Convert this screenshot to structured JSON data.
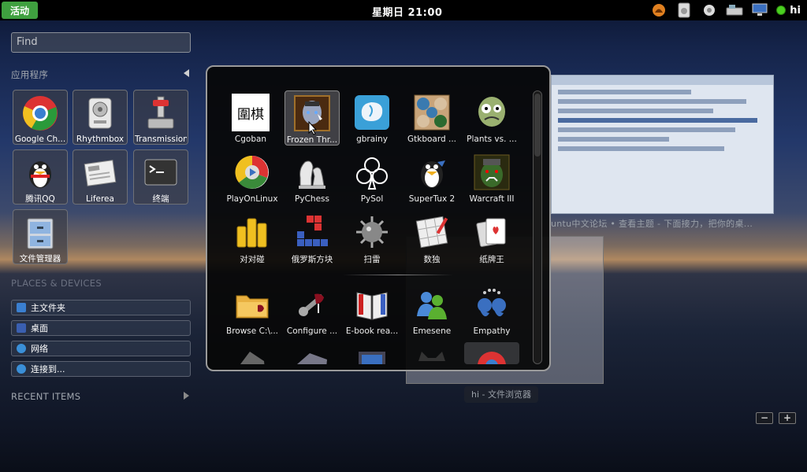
{
  "topbar": {
    "activities": "活动",
    "clock": "星期日 21:00",
    "user": "hi",
    "icons": [
      "user-avatar-icon",
      "removable-device-icon",
      "volume-icon",
      "keyboard-icon",
      "network-icon"
    ]
  },
  "search": {
    "placeholder": "Find"
  },
  "sidebar": {
    "apps_heading": "应用程序",
    "favorites": [
      {
        "label": "Google Ch...",
        "icon": "chrome-icon"
      },
      {
        "label": "Rhythmbox",
        "icon": "rhythmbox-icon"
      },
      {
        "label": "Transmission",
        "icon": "transmission-icon"
      },
      {
        "label": "腾讯QQ",
        "icon": "qq-icon"
      },
      {
        "label": "Liferea",
        "icon": "liferea-icon"
      },
      {
        "label": "终端",
        "icon": "terminal-icon"
      },
      {
        "label": "文件管理器",
        "icon": "file-manager-icon"
      }
    ],
    "places_heading": "PLACES & DEVICES",
    "places": [
      {
        "label": "主文件夹",
        "icon": "home-folder-icon",
        "color": "#3a7fd0"
      },
      {
        "label": "桌面",
        "icon": "desktop-icon",
        "color": "#3a5fb0"
      },
      {
        "label": "网络",
        "icon": "network-globe-icon",
        "color": "#3a8fd8"
      },
      {
        "label": "连接到...",
        "icon": "connect-globe-icon",
        "color": "#3a8fd8"
      }
    ],
    "recent_heading": "RECENT ITEMS"
  },
  "apps": [
    {
      "label": "Cgoban",
      "icon": "cgoban-icon"
    },
    {
      "label": "Frozen Thr...",
      "icon": "frozen-throne-icon"
    },
    {
      "label": "gbrainy",
      "icon": "gbrainy-icon"
    },
    {
      "label": "Gtkboard ...",
      "icon": "gtkboard-icon"
    },
    {
      "label": "Plants vs. ...",
      "icon": "plants-vs-zombies-icon"
    },
    {
      "label": "PlayOnLinux",
      "icon": "playonlinux-icon"
    },
    {
      "label": "PyChess",
      "icon": "pychess-icon"
    },
    {
      "label": "PySol",
      "icon": "pysol-icon"
    },
    {
      "label": "SuperTux 2",
      "icon": "supertux-icon"
    },
    {
      "label": "Warcraft III",
      "icon": "warcraft-icon"
    },
    {
      "label": "对对碰",
      "icon": "match-game-icon"
    },
    {
      "label": "俄罗斯方块",
      "icon": "tetris-icon"
    },
    {
      "label": "扫雷",
      "icon": "mines-icon"
    },
    {
      "label": "数独",
      "icon": "sudoku-icon"
    },
    {
      "label": "纸牌王",
      "icon": "solitaire-icon"
    },
    {
      "label": "Browse C:\\...",
      "icon": "browse-c-icon"
    },
    {
      "label": "Configure ...",
      "icon": "configure-wine-icon"
    },
    {
      "label": "E-book rea...",
      "icon": "ebook-reader-icon"
    },
    {
      "label": "Emesene",
      "icon": "emesene-icon"
    },
    {
      "label": "Empathy",
      "icon": "empathy-icon"
    }
  ],
  "windows": {
    "caption_1": "untu中文论坛 • 查看主题 - 下面接力，把你的桌...",
    "caption_2": "hi - 文件浏览器"
  },
  "zoom": {
    "minus": "−",
    "plus": "+"
  },
  "cgoban_glyph": "圍棋",
  "cards_sudoku": "9"
}
